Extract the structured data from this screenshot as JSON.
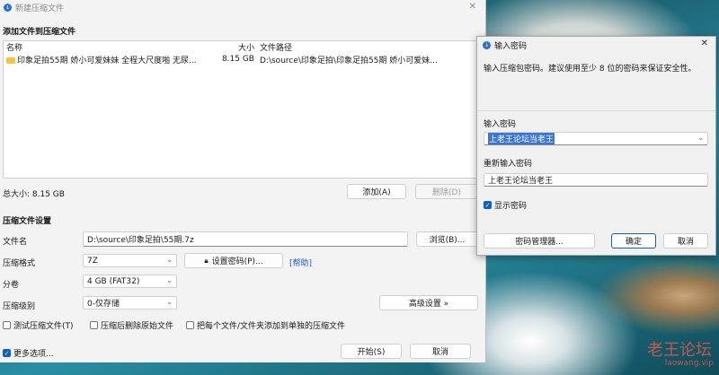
{
  "colors": {
    "accent": "#0b61c4",
    "link": "#1a56c8",
    "folder": "#f5c242"
  },
  "main": {
    "title": "新建压缩文件",
    "add_section": "添加文件到压缩文件",
    "columns": {
      "name": "名称",
      "size": "大小",
      "path": "文件路径"
    },
    "rows": [
      {
        "name": "印象足拍55期 娇小可爱妹妹 全程大尺度啪 无尿...",
        "size": "8.15 GB",
        "path": "D:\\source\\印象足拍\\印象足拍55期 娇小可爱妹..."
      }
    ],
    "total": "总大小: 8.15 GB",
    "add_button": "添加(A)",
    "delete_button": "删除(D)",
    "settings_section": "压缩文件设置",
    "filename_label": "文件名",
    "filename_value": "D:\\source\\印象足拍\\55期.7z",
    "browse_button": "浏览(B)...",
    "format_label": "压缩格式",
    "format_value": "7Z",
    "set_password_button": "设置密码(P)...",
    "help_link": "[帮助]",
    "volume_label": "分卷",
    "volume_value": "4 GB (FAT32)",
    "level_label": "压缩级别",
    "level_value": "0-仅存储",
    "advanced_button": "高级设置 »",
    "test_checkbox": "测试压缩文件(T)",
    "delete_after_checkbox": "压缩后删除原始文件",
    "separate_checkbox": "把每个文件/文件夹添加到单独的压缩文件",
    "more_options": "更多选项...",
    "start_button": "开始(S)",
    "cancel_button": "取消"
  },
  "password_dialog": {
    "title": "输入密码",
    "info": "输入压缩包密码。建议使用至少 8 位的密码来保证安全性。",
    "password_label": "输入密码",
    "password_value": "上老王论坛当老王",
    "repeat_label": "重新输入密码",
    "repeat_value": "上老王论坛当老王",
    "show_password": "显示密码",
    "manager_button": "密码管理器...",
    "ok_button": "确定",
    "cancel_button": "取消"
  },
  "watermark": {
    "text": "老王论坛",
    "sub": "laowang.vip"
  }
}
